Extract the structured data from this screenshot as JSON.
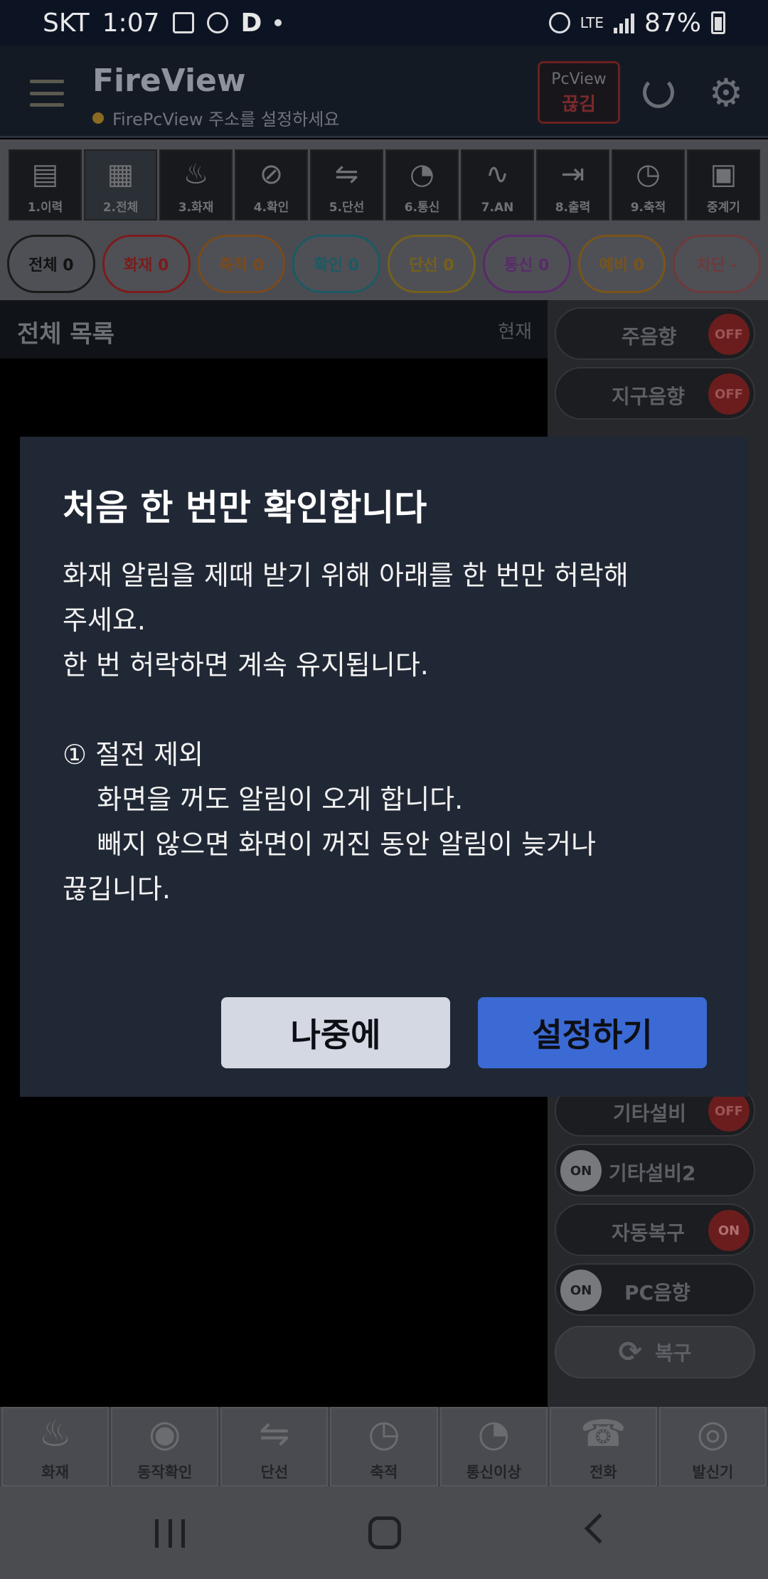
{
  "status_bar": {
    "carrier": "SKT",
    "time": "1:07",
    "network": "LTE",
    "battery": "87%"
  },
  "header": {
    "title": "FireView",
    "subtitle": "FirePcView 주소를 설정하세요",
    "pcview_label": "PcView",
    "pcview_status": "끊김"
  },
  "menu_tiles": [
    {
      "label": "1.이력",
      "icon": "document-icon",
      "glyph": "▤"
    },
    {
      "label": "2.전체",
      "icon": "documents-icon",
      "glyph": "▦"
    },
    {
      "label": "3.화재",
      "icon": "fire-icon",
      "glyph": "♨"
    },
    {
      "label": "4.확인",
      "icon": "magnifier-check-icon",
      "glyph": "⊘"
    },
    {
      "label": "5.단선",
      "icon": "broken-line-icon",
      "glyph": "⇋"
    },
    {
      "label": "6.통신",
      "icon": "satellite-dish-icon",
      "glyph": "◔"
    },
    {
      "label": "7.AN",
      "icon": "wave-icon",
      "glyph": "∿"
    },
    {
      "label": "8.출력",
      "icon": "exit-icon",
      "glyph": "⇥"
    },
    {
      "label": "9.축적",
      "icon": "clock-icon",
      "glyph": "◷"
    },
    {
      "label": "중계기",
      "icon": "repeater-icon",
      "glyph": "▣"
    }
  ],
  "chips": [
    {
      "label": "전체 0",
      "color": "#1a1a1a",
      "text": "#111"
    },
    {
      "label": "화재 0",
      "color": "#7d1b1b",
      "text": "#7d1b1b"
    },
    {
      "label": "축적 0",
      "color": "#7a4a1c",
      "text": "#7a4a1c"
    },
    {
      "label": "확인 0",
      "color": "#1b5a63",
      "text": "#1b5a63"
    },
    {
      "label": "단선 0",
      "color": "#76601a",
      "text": "#76601a"
    },
    {
      "label": "통신 0",
      "color": "#5a2a6a",
      "text": "#5a2a6a"
    },
    {
      "label": "예비 0",
      "color": "#7a5418",
      "text": "#7a5418"
    },
    {
      "label": "차단 -",
      "color": "#6e3a3a",
      "text": "#6e3a3a"
    }
  ],
  "list": {
    "title": "전체 목록",
    "now_label": "현재"
  },
  "toggles_top": [
    {
      "name": "주음향",
      "state": "OFF"
    },
    {
      "name": "지구음향",
      "state": "OFF"
    }
  ],
  "toggles_bottom": [
    {
      "name": "기타설비",
      "state": "OFF",
      "knob": "right"
    },
    {
      "name": "기타설비2",
      "state": "ON",
      "knob": "left"
    },
    {
      "name": "자동복구",
      "state": "ON",
      "knob": "right"
    },
    {
      "name": "PC음향",
      "state": "ON",
      "knob": "left"
    }
  ],
  "recover_button": {
    "label": "복구"
  },
  "bottom_tiles": [
    {
      "label": "화재",
      "icon": "fire-icon",
      "glyph": "♨"
    },
    {
      "label": "동작확인",
      "icon": "eye-icon",
      "glyph": "◉"
    },
    {
      "label": "단선",
      "icon": "broken-line-icon",
      "glyph": "⇋"
    },
    {
      "label": "축적",
      "icon": "clock-icon",
      "glyph": "◷"
    },
    {
      "label": "통신이상",
      "icon": "satellite-dish-icon",
      "glyph": "◔"
    },
    {
      "label": "전화",
      "icon": "telephone-icon",
      "glyph": "☎"
    },
    {
      "label": "발신기",
      "icon": "bell-icon",
      "glyph": "◎"
    }
  ],
  "dialog": {
    "title": "처음 한 번만 확인합니다",
    "body": "화재 알림을 제때 받기 위해 아래를 한 번만 허락해\n주세요.\n한 번 허락하면 계속 유지됩니다.\n\n① 절전 제외\n    화면을 꺼도 알림이 오게 합니다.\n    빼지 않으면 화면이 꺼진 동안 알림이 늦거나\n끊깁니다.",
    "later_label": "나중에",
    "setup_label": "설정하기"
  }
}
